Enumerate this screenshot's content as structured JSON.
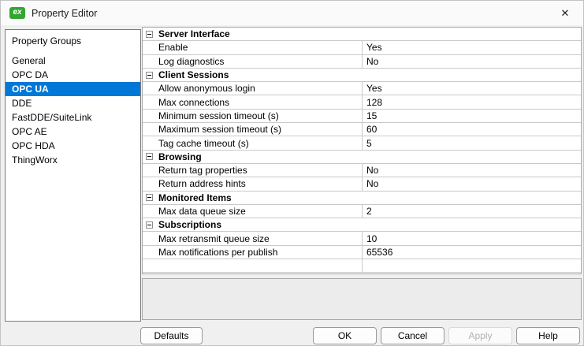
{
  "window": {
    "title": "Property Editor",
    "icon_label": "ex"
  },
  "icons": {
    "close": "✕"
  },
  "colors": {
    "selection_blue": "#0078d7",
    "icon_green": "#33a532"
  },
  "sidebar": {
    "header": "Property Groups",
    "items": [
      {
        "label": "General",
        "selected": false
      },
      {
        "label": "OPC DA",
        "selected": false
      },
      {
        "label": "OPC UA",
        "selected": true
      },
      {
        "label": "DDE",
        "selected": false
      },
      {
        "label": "FastDDE/SuiteLink",
        "selected": false
      },
      {
        "label": "OPC AE",
        "selected": false
      },
      {
        "label": "OPC HDA",
        "selected": false
      },
      {
        "label": "ThingWorx",
        "selected": false
      }
    ]
  },
  "grid": {
    "rows": [
      {
        "type": "header",
        "label": "Server Interface"
      },
      {
        "type": "prop",
        "label": "Enable",
        "value": "Yes"
      },
      {
        "type": "prop",
        "label": "Log diagnostics",
        "value": "No"
      },
      {
        "type": "header",
        "label": "Client Sessions"
      },
      {
        "type": "prop",
        "label": "Allow anonymous login",
        "value": "Yes"
      },
      {
        "type": "prop",
        "label": "Max connections",
        "value": "128"
      },
      {
        "type": "prop",
        "label": "Minimum session timeout (s)",
        "value": "15"
      },
      {
        "type": "prop",
        "label": "Maximum session timeout (s)",
        "value": "60"
      },
      {
        "type": "prop",
        "label": "Tag cache timeout (s)",
        "value": "5"
      },
      {
        "type": "header",
        "label": "Browsing"
      },
      {
        "type": "prop",
        "label": "Return tag properties",
        "value": "No"
      },
      {
        "type": "prop",
        "label": "Return address hints",
        "value": "No"
      },
      {
        "type": "header",
        "label": "Monitored Items"
      },
      {
        "type": "prop",
        "label": "Max data queue size",
        "value": "2"
      },
      {
        "type": "header",
        "label": "Subscriptions"
      },
      {
        "type": "prop",
        "label": "Max retransmit queue size",
        "value": "10"
      },
      {
        "type": "prop",
        "label": "Max notifications per publish",
        "value": "65536"
      },
      {
        "type": "prop",
        "label": "",
        "value": ""
      },
      {
        "type": "empty"
      }
    ]
  },
  "description": {
    "text": ""
  },
  "buttons": {
    "defaults": "Defaults",
    "ok": "OK",
    "cancel": "Cancel",
    "apply": "Apply",
    "help": "Help"
  }
}
